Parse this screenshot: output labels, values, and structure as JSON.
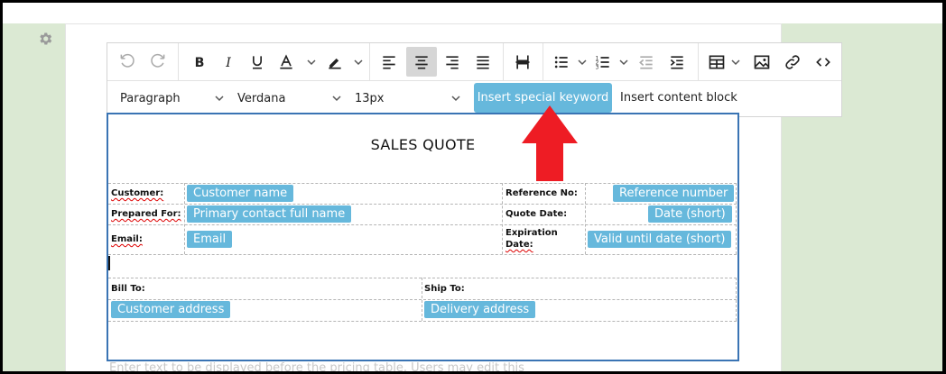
{
  "toolbar": {
    "block_format": "Paragraph",
    "font_family": "Verdana",
    "font_size": "13px",
    "insert_special_keyword": "Insert special keyword",
    "insert_content_block": "Insert content block"
  },
  "document": {
    "title": "SALES QUOTE",
    "labels": {
      "customer": "Customer:",
      "prepared_for": "Prepared For:",
      "email": "Email:",
      "reference_no": "Reference No:",
      "quote_date": "Quote Date:",
      "expiration_date_1": "Expiration",
      "expiration_date_2": "Date:",
      "bill_to": "Bill To:",
      "ship_to": "Ship To:"
    },
    "keywords": {
      "customer_name": "Customer name",
      "primary_contact": "Primary contact full name",
      "email": "Email",
      "reference_number": "Reference number",
      "date_short": "Date (short)",
      "valid_until": "Valid until date (short)",
      "customer_address": "Customer address",
      "delivery_address": "Delivery address"
    }
  },
  "hint_text": "Enter text to be displayed before the pricing table. Users may edit this",
  "colors": {
    "background": "#dbe9d3",
    "keyword_chip": "#66b8dc",
    "editor_border": "#3a74b4",
    "annotation_arrow": "#ee1c24"
  }
}
